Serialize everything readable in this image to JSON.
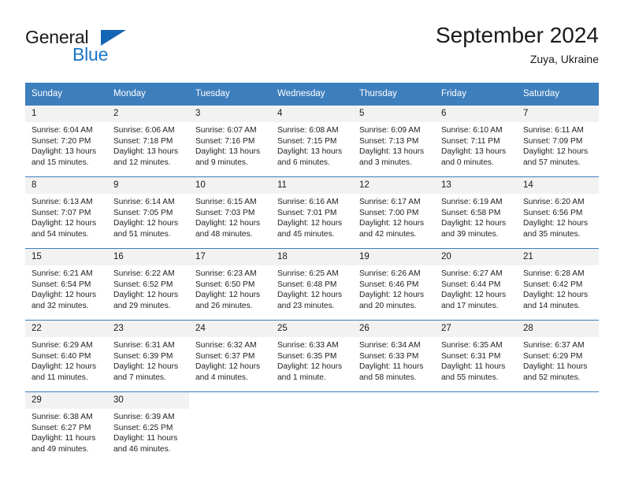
{
  "brand": {
    "line1": "General",
    "line2": "Blue",
    "triangle_color": "#1565b5",
    "blue_color": "#1a74c4"
  },
  "header": {
    "title": "September 2024",
    "location": "Zuya, Ukraine"
  },
  "theme": {
    "header_bg": "#3d7ebd",
    "daynum_bg": "#f2f2f2",
    "text": "#1a1a1a"
  },
  "weekday_headers": [
    "Sunday",
    "Monday",
    "Tuesday",
    "Wednesday",
    "Thursday",
    "Friday",
    "Saturday"
  ],
  "labels": {
    "sunrise_prefix": "Sunrise:",
    "sunset_prefix": "Sunset:",
    "daylight_prefix": "Daylight:"
  },
  "weeks": [
    [
      {
        "day": "1",
        "sunrise": "Sunrise: 6:04 AM",
        "sunset": "Sunset: 7:20 PM",
        "daylight1": "Daylight: 13 hours",
        "daylight2": "and 15 minutes."
      },
      {
        "day": "2",
        "sunrise": "Sunrise: 6:06 AM",
        "sunset": "Sunset: 7:18 PM",
        "daylight1": "Daylight: 13 hours",
        "daylight2": "and 12 minutes."
      },
      {
        "day": "3",
        "sunrise": "Sunrise: 6:07 AM",
        "sunset": "Sunset: 7:16 PM",
        "daylight1": "Daylight: 13 hours",
        "daylight2": "and 9 minutes."
      },
      {
        "day": "4",
        "sunrise": "Sunrise: 6:08 AM",
        "sunset": "Sunset: 7:15 PM",
        "daylight1": "Daylight: 13 hours",
        "daylight2": "and 6 minutes."
      },
      {
        "day": "5",
        "sunrise": "Sunrise: 6:09 AM",
        "sunset": "Sunset: 7:13 PM",
        "daylight1": "Daylight: 13 hours",
        "daylight2": "and 3 minutes."
      },
      {
        "day": "6",
        "sunrise": "Sunrise: 6:10 AM",
        "sunset": "Sunset: 7:11 PM",
        "daylight1": "Daylight: 13 hours",
        "daylight2": "and 0 minutes."
      },
      {
        "day": "7",
        "sunrise": "Sunrise: 6:11 AM",
        "sunset": "Sunset: 7:09 PM",
        "daylight1": "Daylight: 12 hours",
        "daylight2": "and 57 minutes."
      }
    ],
    [
      {
        "day": "8",
        "sunrise": "Sunrise: 6:13 AM",
        "sunset": "Sunset: 7:07 PM",
        "daylight1": "Daylight: 12 hours",
        "daylight2": "and 54 minutes."
      },
      {
        "day": "9",
        "sunrise": "Sunrise: 6:14 AM",
        "sunset": "Sunset: 7:05 PM",
        "daylight1": "Daylight: 12 hours",
        "daylight2": "and 51 minutes."
      },
      {
        "day": "10",
        "sunrise": "Sunrise: 6:15 AM",
        "sunset": "Sunset: 7:03 PM",
        "daylight1": "Daylight: 12 hours",
        "daylight2": "and 48 minutes."
      },
      {
        "day": "11",
        "sunrise": "Sunrise: 6:16 AM",
        "sunset": "Sunset: 7:01 PM",
        "daylight1": "Daylight: 12 hours",
        "daylight2": "and 45 minutes."
      },
      {
        "day": "12",
        "sunrise": "Sunrise: 6:17 AM",
        "sunset": "Sunset: 7:00 PM",
        "daylight1": "Daylight: 12 hours",
        "daylight2": "and 42 minutes."
      },
      {
        "day": "13",
        "sunrise": "Sunrise: 6:19 AM",
        "sunset": "Sunset: 6:58 PM",
        "daylight1": "Daylight: 12 hours",
        "daylight2": "and 39 minutes."
      },
      {
        "day": "14",
        "sunrise": "Sunrise: 6:20 AM",
        "sunset": "Sunset: 6:56 PM",
        "daylight1": "Daylight: 12 hours",
        "daylight2": "and 35 minutes."
      }
    ],
    [
      {
        "day": "15",
        "sunrise": "Sunrise: 6:21 AM",
        "sunset": "Sunset: 6:54 PM",
        "daylight1": "Daylight: 12 hours",
        "daylight2": "and 32 minutes."
      },
      {
        "day": "16",
        "sunrise": "Sunrise: 6:22 AM",
        "sunset": "Sunset: 6:52 PM",
        "daylight1": "Daylight: 12 hours",
        "daylight2": "and 29 minutes."
      },
      {
        "day": "17",
        "sunrise": "Sunrise: 6:23 AM",
        "sunset": "Sunset: 6:50 PM",
        "daylight1": "Daylight: 12 hours",
        "daylight2": "and 26 minutes."
      },
      {
        "day": "18",
        "sunrise": "Sunrise: 6:25 AM",
        "sunset": "Sunset: 6:48 PM",
        "daylight1": "Daylight: 12 hours",
        "daylight2": "and 23 minutes."
      },
      {
        "day": "19",
        "sunrise": "Sunrise: 6:26 AM",
        "sunset": "Sunset: 6:46 PM",
        "daylight1": "Daylight: 12 hours",
        "daylight2": "and 20 minutes."
      },
      {
        "day": "20",
        "sunrise": "Sunrise: 6:27 AM",
        "sunset": "Sunset: 6:44 PM",
        "daylight1": "Daylight: 12 hours",
        "daylight2": "and 17 minutes."
      },
      {
        "day": "21",
        "sunrise": "Sunrise: 6:28 AM",
        "sunset": "Sunset: 6:42 PM",
        "daylight1": "Daylight: 12 hours",
        "daylight2": "and 14 minutes."
      }
    ],
    [
      {
        "day": "22",
        "sunrise": "Sunrise: 6:29 AM",
        "sunset": "Sunset: 6:40 PM",
        "daylight1": "Daylight: 12 hours",
        "daylight2": "and 11 minutes."
      },
      {
        "day": "23",
        "sunrise": "Sunrise: 6:31 AM",
        "sunset": "Sunset: 6:39 PM",
        "daylight1": "Daylight: 12 hours",
        "daylight2": "and 7 minutes."
      },
      {
        "day": "24",
        "sunrise": "Sunrise: 6:32 AM",
        "sunset": "Sunset: 6:37 PM",
        "daylight1": "Daylight: 12 hours",
        "daylight2": "and 4 minutes."
      },
      {
        "day": "25",
        "sunrise": "Sunrise: 6:33 AM",
        "sunset": "Sunset: 6:35 PM",
        "daylight1": "Daylight: 12 hours",
        "daylight2": "and 1 minute."
      },
      {
        "day": "26",
        "sunrise": "Sunrise: 6:34 AM",
        "sunset": "Sunset: 6:33 PM",
        "daylight1": "Daylight: 11 hours",
        "daylight2": "and 58 minutes."
      },
      {
        "day": "27",
        "sunrise": "Sunrise: 6:35 AM",
        "sunset": "Sunset: 6:31 PM",
        "daylight1": "Daylight: 11 hours",
        "daylight2": "and 55 minutes."
      },
      {
        "day": "28",
        "sunrise": "Sunrise: 6:37 AM",
        "sunset": "Sunset: 6:29 PM",
        "daylight1": "Daylight: 11 hours",
        "daylight2": "and 52 minutes."
      }
    ],
    [
      {
        "day": "29",
        "sunrise": "Sunrise: 6:38 AM",
        "sunset": "Sunset: 6:27 PM",
        "daylight1": "Daylight: 11 hours",
        "daylight2": "and 49 minutes."
      },
      {
        "day": "30",
        "sunrise": "Sunrise: 6:39 AM",
        "sunset": "Sunset: 6:25 PM",
        "daylight1": "Daylight: 11 hours",
        "daylight2": "and 46 minutes."
      },
      {
        "day": "",
        "sunrise": "",
        "sunset": "",
        "daylight1": "",
        "daylight2": ""
      },
      {
        "day": "",
        "sunrise": "",
        "sunset": "",
        "daylight1": "",
        "daylight2": ""
      },
      {
        "day": "",
        "sunrise": "",
        "sunset": "",
        "daylight1": "",
        "daylight2": ""
      },
      {
        "day": "",
        "sunrise": "",
        "sunset": "",
        "daylight1": "",
        "daylight2": ""
      },
      {
        "day": "",
        "sunrise": "",
        "sunset": "",
        "daylight1": "",
        "daylight2": ""
      }
    ]
  ]
}
